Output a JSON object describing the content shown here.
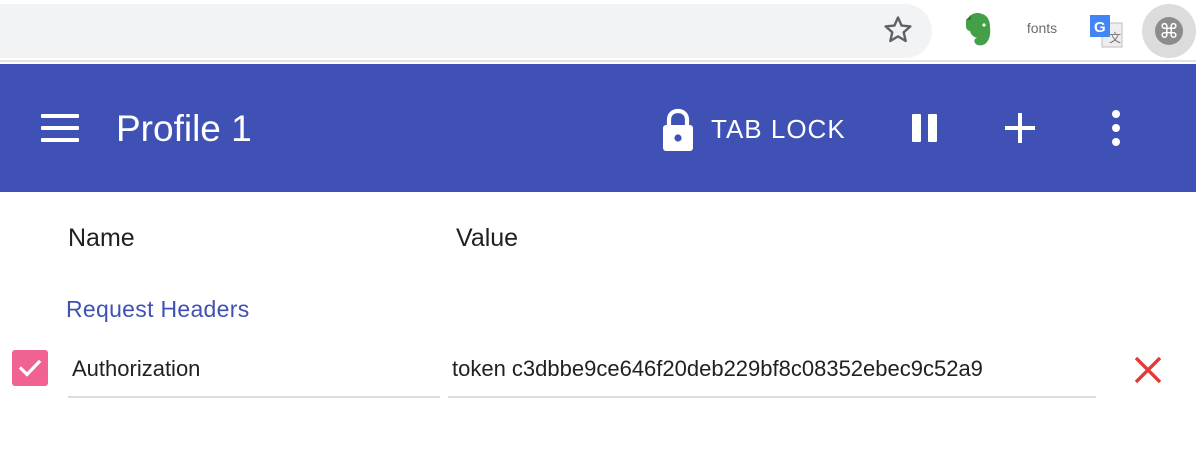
{
  "browser": {
    "extensions": {
      "fonts_label": "fonts",
      "modheader_glyph": "⌘"
    }
  },
  "appbar": {
    "title": "Profile 1",
    "tab_lock_label": "TAB LOCK",
    "background_color": "#3f51b5"
  },
  "columns": {
    "name_header": "Name",
    "value_header": "Value"
  },
  "section": {
    "title": "Request Headers"
  },
  "headers": [
    {
      "enabled": true,
      "name": "Authorization",
      "value": "token c3dbbe9ce646f20deb229bf8c08352ebec9c52a9"
    }
  ],
  "colors": {
    "accent": "#3f51b5",
    "checkbox": "#f06292",
    "delete": "#e53935"
  }
}
